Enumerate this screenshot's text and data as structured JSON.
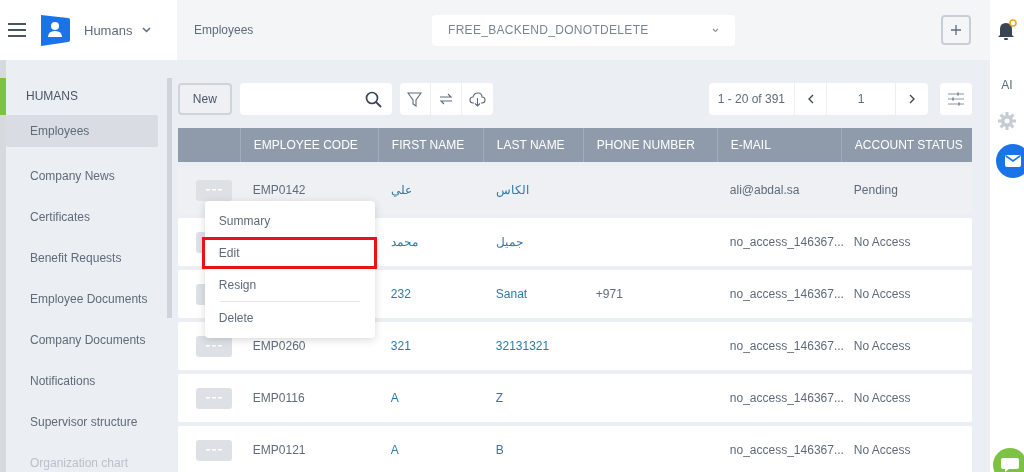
{
  "app": {
    "module": "Humans",
    "breadcrumb": "Employees",
    "company": "FREE_BACKEND_DONOTDELETE"
  },
  "rail": {
    "notification_badge": true,
    "ai_label": "AI"
  },
  "sidebar": {
    "title": "HUMANS",
    "items": [
      {
        "label": "Employees",
        "selected": true
      },
      {
        "label": "Company News",
        "selected": false
      },
      {
        "label": "Certificates",
        "selected": false
      },
      {
        "label": "Benefit Requests",
        "selected": false
      },
      {
        "label": "Employee Documents",
        "selected": false
      },
      {
        "label": "Company Documents",
        "selected": false
      },
      {
        "label": "Notifications",
        "selected": false
      },
      {
        "label": "Supervisor structure",
        "selected": false
      },
      {
        "label": "Organization chart",
        "selected": false
      }
    ]
  },
  "toolbar": {
    "new_button": "New",
    "pagination": {
      "range": "1 - 20 of 391",
      "page": "1"
    }
  },
  "table": {
    "columns": [
      "EMPLOYEE CODE",
      "FIRST NAME",
      "LAST NAME",
      "PHONE NUMBER",
      "E-MAIL",
      "ACCOUNT STATUS"
    ],
    "rows": [
      {
        "code": "EMP0142",
        "first": "علي",
        "last": "الكاس",
        "phone": "",
        "email": "ali@abdal.sa",
        "status": "Pending",
        "selected": true
      },
      {
        "code": "",
        "first": "محمد",
        "last": "جميل",
        "phone": "",
        "email": "no_access_146367...",
        "status": "No Access",
        "selected": false
      },
      {
        "code": "",
        "first": "232",
        "last": "Sanat",
        "phone": "+971",
        "email": "no_access_146367...",
        "status": "No Access",
        "selected": false
      },
      {
        "code": "EMP0260",
        "first": "321",
        "last": "32131321",
        "phone": "",
        "email": "no_access_146367...",
        "status": "No Access",
        "selected": false
      },
      {
        "code": "EMP0116",
        "first": "A",
        "last": "Z",
        "phone": "",
        "email": "no_access_146367...",
        "status": "No Access",
        "selected": false
      },
      {
        "code": "EMP0121",
        "first": "A",
        "last": "B",
        "phone": "",
        "email": "no_access_146367...",
        "status": "No Access",
        "selected": false
      }
    ]
  },
  "context_menu": {
    "items": [
      {
        "label": "Summary",
        "highlighted": false
      },
      {
        "label": "Edit",
        "highlighted": true
      },
      {
        "label": "Resign",
        "highlighted": false
      },
      {
        "label": "Delete",
        "highlighted": false
      }
    ]
  }
}
